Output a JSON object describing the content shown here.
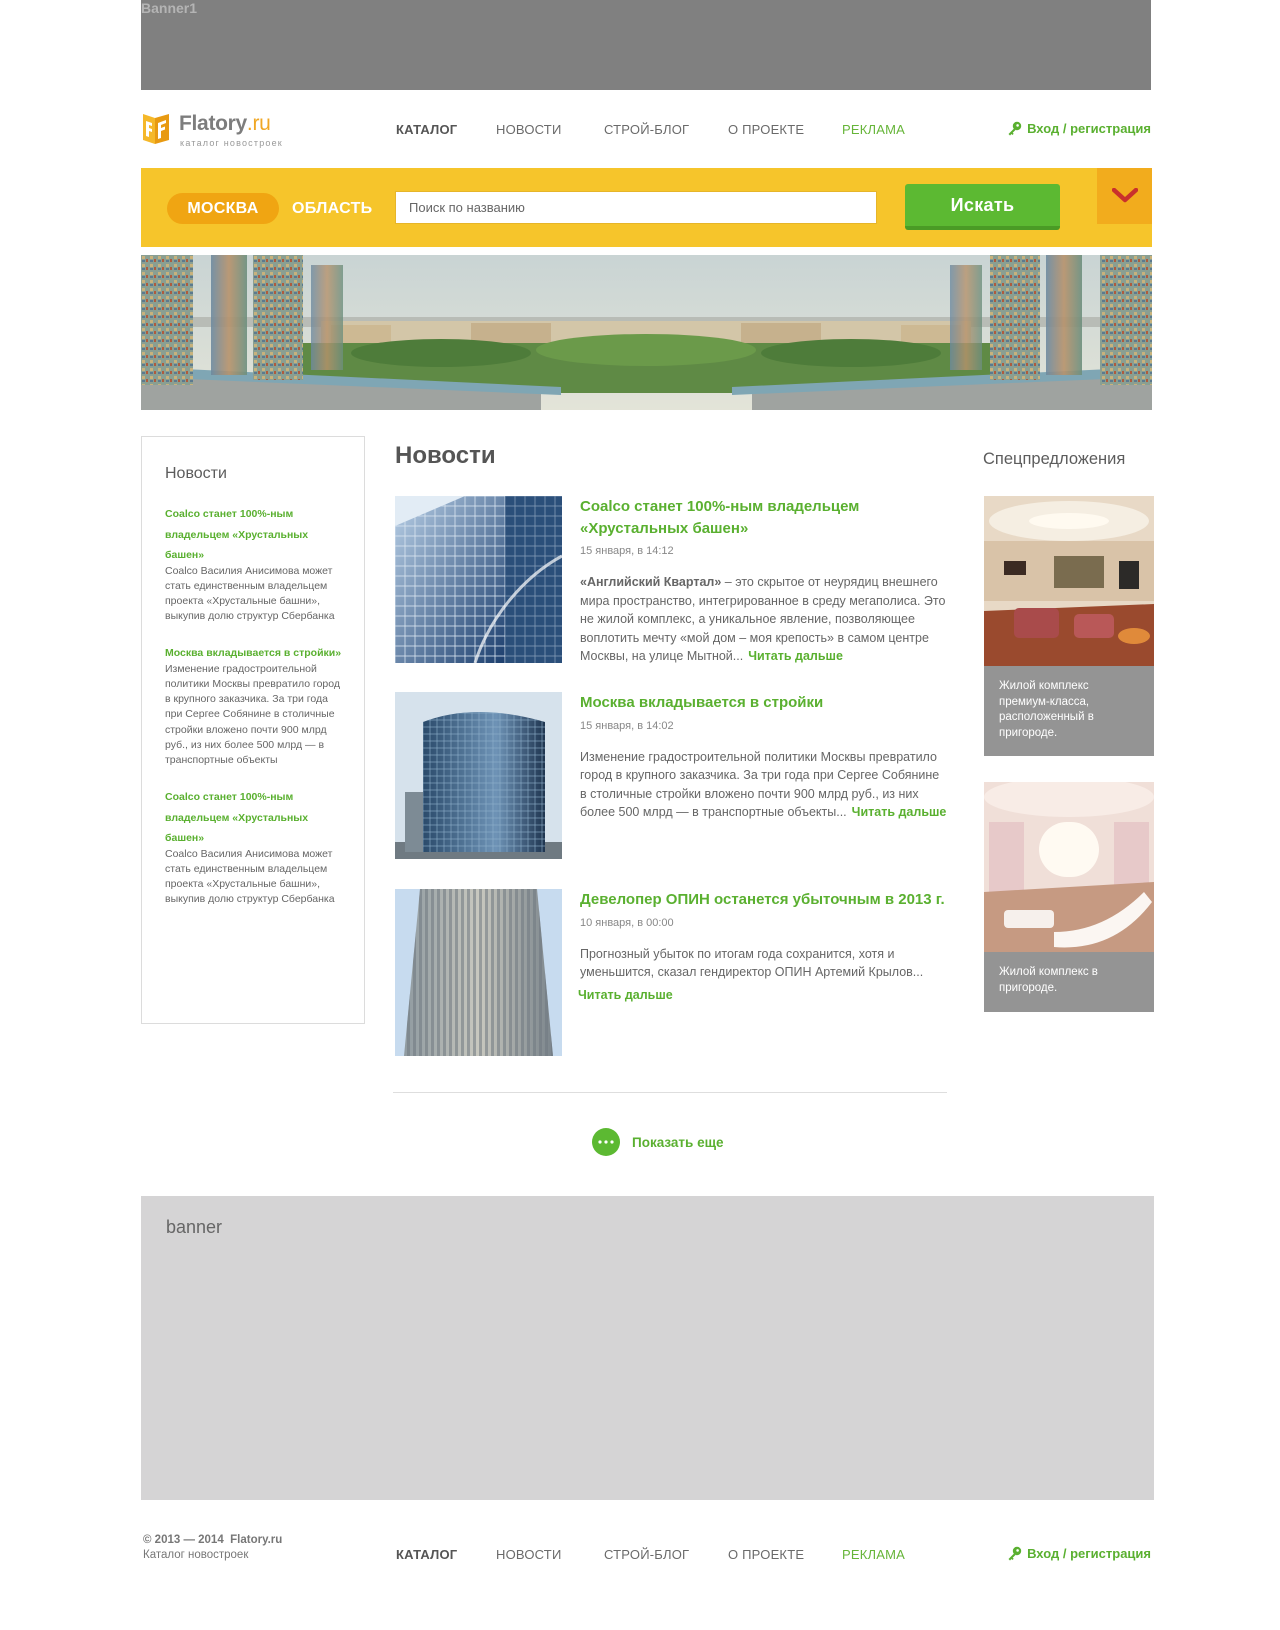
{
  "top_banner": {
    "label": "Banner1"
  },
  "logo": {
    "name_main": "Flatory",
    "name_suffix": ".ru",
    "tagline": "каталог новостроек"
  },
  "nav": {
    "items": [
      {
        "label": "КАТАЛОГ"
      },
      {
        "label": "НОВОСТИ"
      },
      {
        "label": "СТРОЙ-БЛОГ"
      },
      {
        "label": "О ПРОЕКТЕ"
      },
      {
        "label": "РЕКЛАМА"
      }
    ],
    "login": "Вход / регистрация"
  },
  "search": {
    "city_tab": "МОСКВА",
    "region_tab": "ОБЛАСТЬ",
    "placeholder": "Поиск по названию",
    "button": "Искать"
  },
  "sidebar": {
    "title": "Новости",
    "items": [
      {
        "link": "Coalco станет 100%-ным владельцем «Хрустальных башен»",
        "text": "Coalco Василия Анисимова может стать единственным владельцем проекта «Хрустальные башни», выкупив долю структур Сбербанка"
      },
      {
        "link": "Москва вкладывается в стройки»",
        "text": "Изменение градостроительной политики Москвы превратило город в крупного заказчика. За три года при Сергее Собянине в столичные стройки вложено почти 900 млрд руб., из них более 500 млрд — в транспортные объекты"
      },
      {
        "link": "Coalco станет 100%-ным владельцем «Хрустальных башен»",
        "text": "Coalco Василия Анисимова может стать единственным владельцем проекта «Хрустальные башни», выкупив долю структур Сбербанка"
      }
    ]
  },
  "main": {
    "title": "Новости",
    "news": [
      {
        "title": "Coalco станет 100%-ным владельцем «Хрустальных башен»",
        "date": "15 января, в 14:12",
        "lead": "«Английский Квартал»",
        "text": " – это скрытое от неурядиц внешнего мира пространство, интегрированное в среду мегаполиса. Это не жилой комплекс, а уникальное явление, позволяющее воплотить мечту «мой дом – моя крепость» в самом центре Москвы, на улице Мытной...",
        "more": "Читать дальше"
      },
      {
        "title": "Москва вкладывается в стройки",
        "date": "15 января, в 14:02",
        "text": "Изменение градостроительной политики Москвы превратило город в крупного заказчика. За три года при Сергее Собянине в столичные стройки вложено почти 900 млрд руб., из них более 500 млрд — в транспортные объекты...",
        "more": "Читать дальше"
      },
      {
        "title": "Девелопер ОПИН останется убыточным в 2013 г.",
        "date": "10 января, в 00:00",
        "text": "Прогнозный убыток по итогам года сохранится, хотя и уменьшится, сказал гендиректор ОПИН Артемий Крылов...",
        "more": "Читать дальше"
      }
    ],
    "show_more": "Показать еще"
  },
  "offers": {
    "title": "Спецпредложения",
    "items": [
      {
        "caption": "Жилой комплекс премиум-класса, расположенный в пригороде."
      },
      {
        "caption": "Жилой комплекс в пригороде."
      }
    ]
  },
  "bottom_banner": {
    "label": "banner"
  },
  "footer": {
    "copyright": "© 2013 — 2014",
    "site": "Flatory.ru",
    "tagline": "Каталог новостроек"
  },
  "colors": {
    "accent_green": "#5ab030",
    "yellow": "#f6c52b",
    "orange": "#f0a512"
  }
}
